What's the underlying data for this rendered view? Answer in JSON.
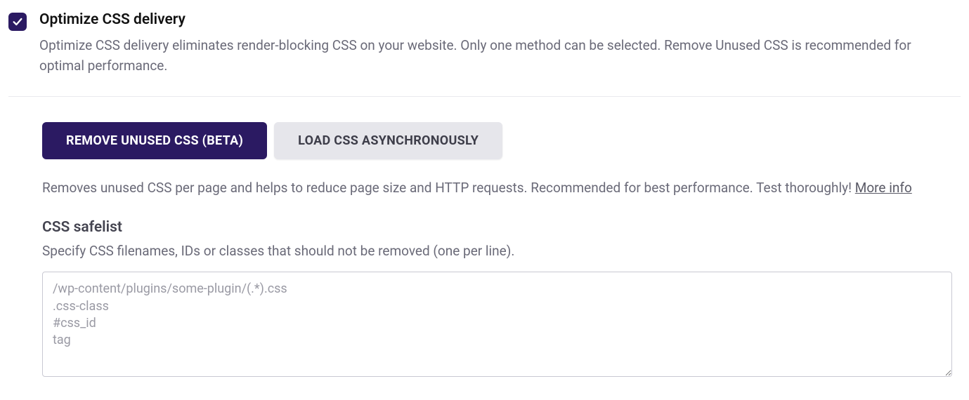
{
  "header": {
    "title": "Optimize CSS delivery",
    "description": "Optimize CSS delivery eliminates render-blocking CSS on your website. Only one method can be selected. Remove Unused CSS is recommended for optimal performance.",
    "checked": true
  },
  "tabs": {
    "active": "REMOVE UNUSED CSS (BETA)",
    "inactive": "LOAD CSS ASYNCHRONOUSLY",
    "description": "Removes unused CSS per page and helps to reduce page size and HTTP requests. Recommended for best performance. Test thoroughly! ",
    "more_info": "More info"
  },
  "safelist": {
    "title": "CSS safelist",
    "description": "Specify CSS filenames, IDs or classes that should not be removed (one per line).",
    "placeholder": "/wp-content/plugins/some-plugin/(.*).css\n.css-class\n#css_id\ntag"
  }
}
